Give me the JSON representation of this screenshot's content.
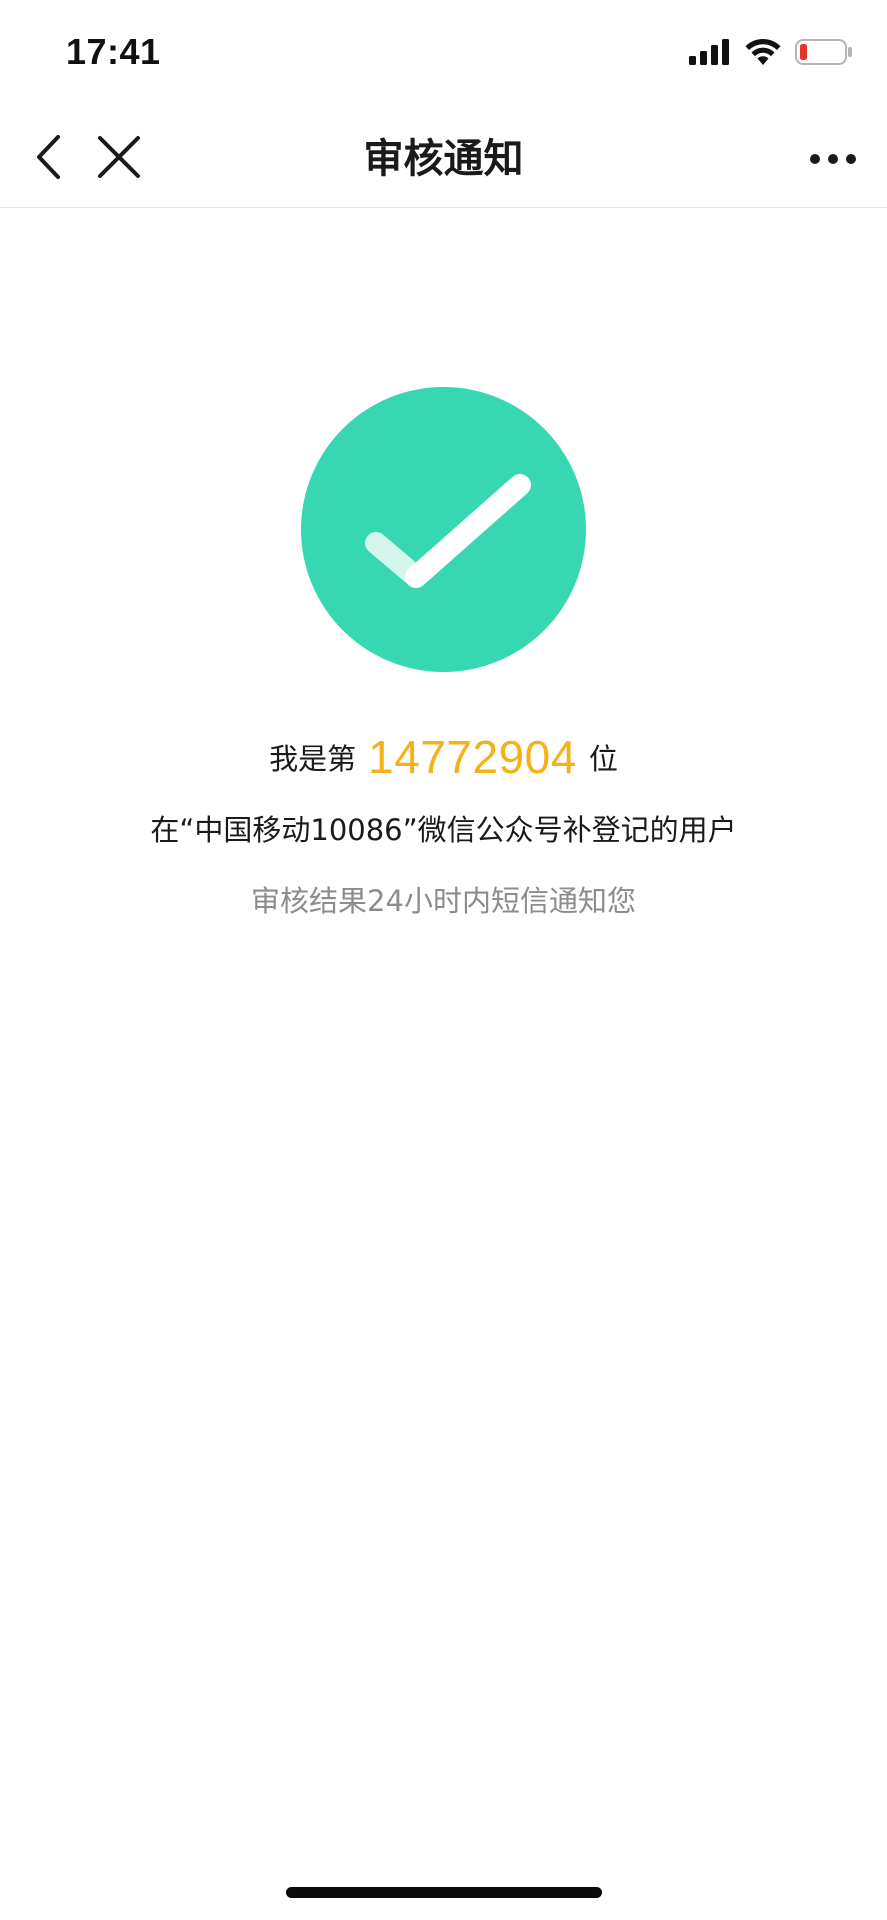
{
  "status_bar": {
    "time": "17:41",
    "icons": [
      "signal-icon",
      "wifi-icon",
      "battery-low-icon"
    ],
    "battery_color": "#e5342b"
  },
  "nav": {
    "title": "审核通知",
    "back_icon": "chevron-left-icon",
    "close_icon": "close-icon",
    "more_icon": "more-icon"
  },
  "result": {
    "icon": "check-circle-icon",
    "icon_color": "#37d8b1",
    "queue_prefix": "我是第",
    "queue_number": "14772904",
    "queue_suffix": "位",
    "queue_number_color": "#f5b01a",
    "channel_text": "在“中国移动10086”微信公众号补登记的用户",
    "notice_text": "审核结果24小时内短信通知您"
  }
}
